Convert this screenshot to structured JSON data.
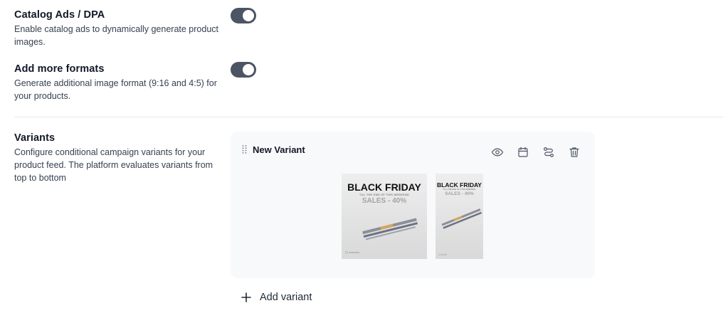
{
  "settings": {
    "catalog": {
      "title": "Catalog Ads / DPA",
      "description": "Enable catalog ads to dynamically generate product images.",
      "enabled": true
    },
    "formats": {
      "title": "Add more formats",
      "description": "Generate additional image format (9:16 and 4:5) for your products.",
      "enabled": true
    },
    "variants": {
      "title": "Variants",
      "description": "Configure conditional campaign variants for your product feed. The platform evaluates variants from top to bottom"
    }
  },
  "variant_card": {
    "name": "New Variant",
    "actions": [
      "eye-icon",
      "calendar-icon",
      "route-icon",
      "trash-icon"
    ],
    "previews": [
      {
        "headline": "BLACK FRIDAY",
        "subline": "TILL THE END OF THIS WEEKEND",
        "sale": "SALES - 40%",
        "format": "square"
      },
      {
        "headline": "BLACK FRIDAY",
        "subline": "TILL THE END OF THIS WEEKEND",
        "sale": "SALES - 40%",
        "format": "vertical"
      }
    ]
  },
  "add_variant_label": "Add variant",
  "colors": {
    "toggle_on": "#4b5563",
    "card_bg": "#f8f9fa",
    "divider": "#e5e7eb"
  }
}
